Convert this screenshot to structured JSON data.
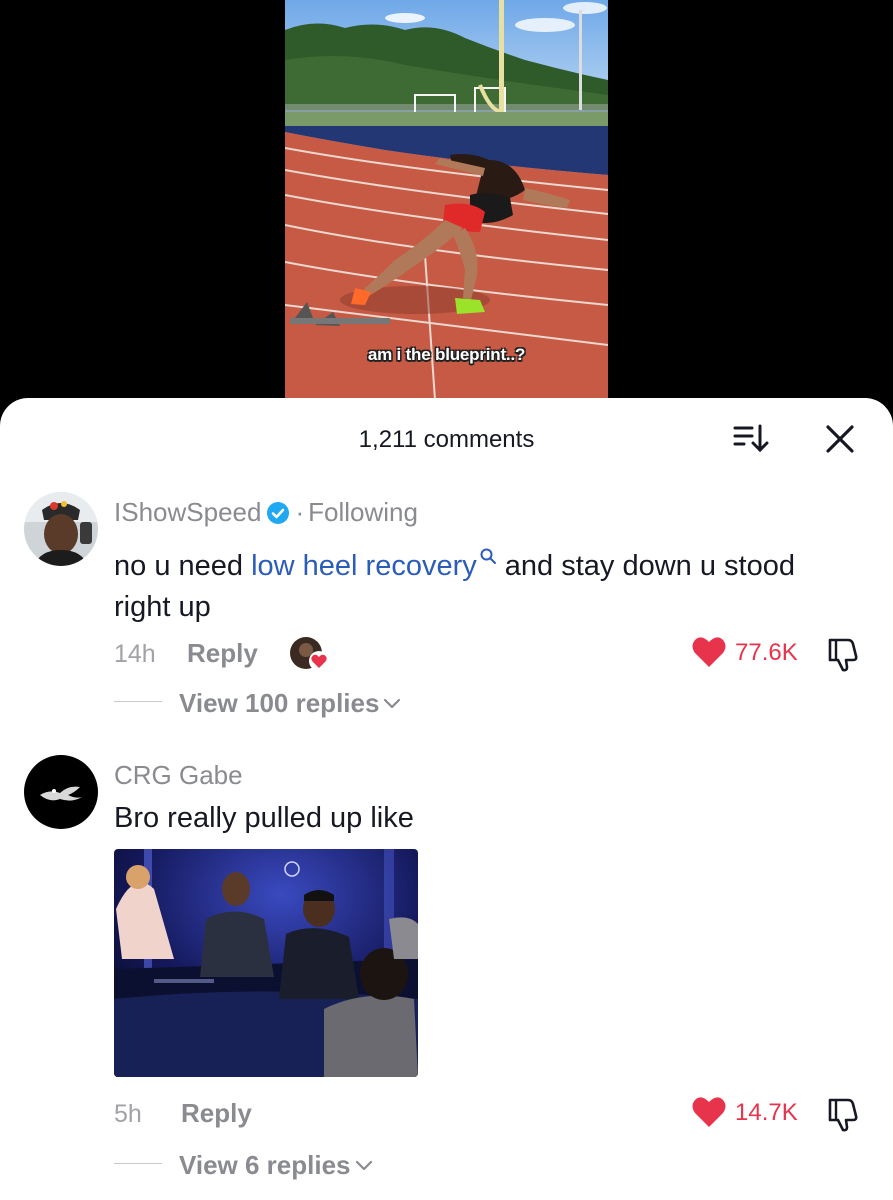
{
  "video": {
    "caption": "am i the blueprint..?"
  },
  "header": {
    "comment_count": "1,211 comments",
    "sort_icon": "sort-icon",
    "close_icon": "close-icon"
  },
  "comments": [
    {
      "username": "IShowSpeed",
      "verified": true,
      "separator": "·",
      "relation": "Following",
      "text_before": "no u need ",
      "keyword": "low heel recovery",
      "text_after": " and stay down u stood right up",
      "time": "14h",
      "reply_label": "Reply",
      "likes": "77.6K",
      "view_replies": "View 100 replies",
      "liked_by_creator": true
    },
    {
      "username": "CRG Gabe",
      "text": "Bro really pulled up like",
      "has_media": true,
      "time": "5h",
      "reply_label": "Reply",
      "likes": "14.7K",
      "view_replies": "View 6 replies"
    }
  ],
  "colors": {
    "like_red": "#e8334c",
    "keyword_blue": "#2b5cb8",
    "verified_blue": "#20d5ec",
    "muted_text": "#8a8b91"
  }
}
